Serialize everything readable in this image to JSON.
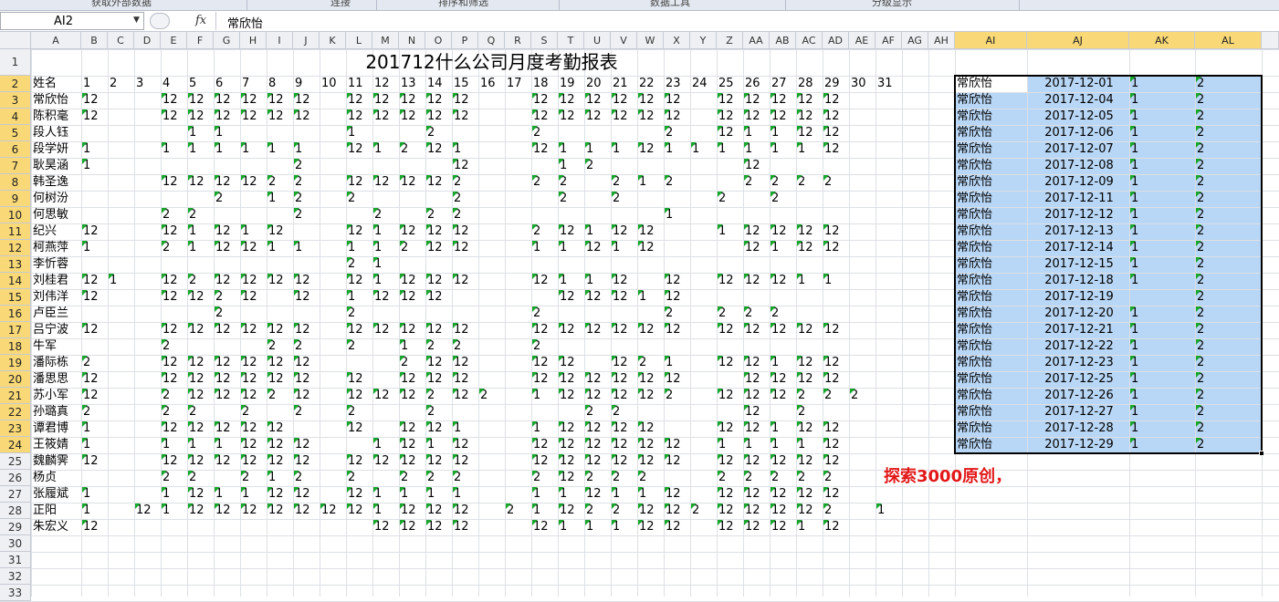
{
  "ribbon": {
    "groups": [
      "获取外部数据",
      "连接",
      "排序和筛选",
      "数据工具",
      "分级显示"
    ]
  },
  "formula_bar": {
    "name_box": "AI2",
    "fx": "fx",
    "content": "常欣怡"
  },
  "columns": [
    "A",
    "B",
    "C",
    "D",
    "E",
    "F",
    "G",
    "H",
    "I",
    "J",
    "K",
    "L",
    "M",
    "N",
    "O",
    "P",
    "Q",
    "R",
    "S",
    "T",
    "U",
    "V",
    "W",
    "X",
    "Y",
    "Z",
    "AA",
    "AB",
    "AC",
    "AD",
    "AE",
    "AF",
    "AG",
    "AH",
    "AI",
    "AJ",
    "AK",
    "AL"
  ],
  "selected_columns": [
    "AI",
    "AJ",
    "AK",
    "AL"
  ],
  "rows": [
    "1",
    "2",
    "3",
    "4",
    "5",
    "6",
    "7",
    "8",
    "9",
    "10",
    "11",
    "12",
    "13",
    "14",
    "15",
    "16",
    "17",
    "18",
    "19",
    "20",
    "21",
    "22",
    "23",
    "24",
    "25",
    "26",
    "27",
    "28",
    "29",
    "30",
    "31",
    "32",
    "33"
  ],
  "selected_rows": [
    "2",
    "3",
    "4",
    "5",
    "6",
    "7",
    "8",
    "9",
    "10",
    "11",
    "12",
    "13",
    "14",
    "15",
    "16",
    "17",
    "18",
    "19",
    "20",
    "21",
    "22",
    "23",
    "24"
  ],
  "sheet": {
    "title": "201712什么公司月度考勤报表",
    "header_label": "姓名",
    "days": [
      "1",
      "2",
      "3",
      "4",
      "5",
      "6",
      "7",
      "8",
      "9",
      "10",
      "11",
      "12",
      "13",
      "14",
      "15",
      "16",
      "17",
      "18",
      "19",
      "20",
      "21",
      "22",
      "23",
      "24",
      "25",
      "26",
      "27",
      "28",
      "29",
      "30",
      "31"
    ],
    "employees": [
      {
        "name": "常欣怡",
        "v": [
          "12",
          "",
          "",
          "12",
          "12",
          "12",
          "12",
          "12",
          "12",
          "",
          "12",
          "12",
          "12",
          "12",
          "12",
          "",
          "",
          "12",
          "12",
          "12",
          "12",
          "12",
          "12",
          "",
          "12",
          "12",
          "12",
          "12",
          "12",
          "",
          ""
        ]
      },
      {
        "name": "陈积毫",
        "v": [
          "12",
          "",
          "",
          "12",
          "12",
          "12",
          "12",
          "12",
          "12",
          "",
          "12",
          "12",
          "12",
          "12",
          "12",
          "",
          "",
          "12",
          "12",
          "12",
          "12",
          "12",
          "12",
          "",
          "12",
          "12",
          "12",
          "12",
          "12",
          "",
          ""
        ]
      },
      {
        "name": "段人钰",
        "v": [
          "",
          "",
          "",
          "",
          "1",
          "1",
          "",
          "",
          "",
          "",
          "1",
          "",
          "",
          "2",
          "",
          "",
          "",
          "2",
          "",
          "",
          "",
          "",
          "2",
          "",
          "12",
          "1",
          "1",
          "12",
          "12",
          "",
          ""
        ]
      },
      {
        "name": "段学妍",
        "v": [
          "1",
          "",
          "",
          "1",
          "1",
          "1",
          "1",
          "1",
          "1",
          "",
          "12",
          "1",
          "2",
          "12",
          "1",
          "",
          "",
          "12",
          "1",
          "1",
          "1",
          "12",
          "1",
          "1",
          "1",
          "1",
          "1",
          "1",
          "12",
          "",
          ""
        ]
      },
      {
        "name": "耿昊涵",
        "v": [
          "1",
          "",
          "",
          "",
          "",
          "",
          "",
          "",
          "2",
          "",
          "",
          "",
          "",
          "",
          "12",
          "",
          "",
          "",
          "1",
          "2",
          "",
          "",
          "",
          "",
          "",
          "12",
          "",
          "",
          "",
          "",
          ""
        ]
      },
      {
        "name": "韩圣逸",
        "v": [
          "",
          "",
          "",
          "12",
          "12",
          "12",
          "12",
          "2",
          "2",
          "",
          "12",
          "12",
          "12",
          "12",
          "2",
          "",
          "",
          "2",
          "2",
          "",
          "2",
          "1",
          "2",
          "",
          "",
          "2",
          "2",
          "2",
          "2",
          "",
          ""
        ]
      },
      {
        "name": "何树汾",
        "v": [
          "",
          "",
          "",
          "",
          "",
          "2",
          "",
          "1",
          "2",
          "",
          "2",
          "",
          "",
          "",
          "2",
          "",
          "",
          "",
          "2",
          "",
          "2",
          "",
          "",
          "",
          "2",
          "",
          "2",
          "",
          "",
          "",
          ""
        ]
      },
      {
        "name": "何思敏",
        "v": [
          "",
          "",
          "",
          "2",
          "2",
          "",
          "",
          "",
          "2",
          "",
          "",
          "2",
          "",
          "2",
          "2",
          "",
          "",
          "",
          "",
          "",
          "",
          "",
          "1",
          "",
          "",
          "",
          "",
          "",
          "",
          "",
          ""
        ]
      },
      {
        "name": "纪兴",
        "v": [
          "12",
          "",
          "",
          "12",
          "1",
          "12",
          "1",
          "12",
          "",
          "",
          "12",
          "1",
          "12",
          "12",
          "12",
          "",
          "",
          "2",
          "12",
          "1",
          "12",
          "12",
          "",
          "",
          "1",
          "12",
          "12",
          "12",
          "12",
          "",
          ""
        ]
      },
      {
        "name": "柯燕萍",
        "v": [
          "1",
          "",
          "",
          "2",
          "1",
          "12",
          "12",
          "1",
          "1",
          "",
          "1",
          "1",
          "2",
          "12",
          "12",
          "",
          "",
          "1",
          "1",
          "12",
          "1",
          "12",
          "",
          "",
          "",
          "12",
          "1",
          "12",
          "12",
          "",
          ""
        ]
      },
      {
        "name": "李忻蓉",
        "v": [
          "",
          "",
          "",
          "",
          "",
          "",
          "",
          "",
          "",
          "",
          "2",
          "1",
          "",
          "",
          "",
          "",
          "",
          "",
          "",
          "",
          "",
          "",
          "",
          "",
          "",
          "",
          "",
          "",
          "",
          "",
          ""
        ]
      },
      {
        "name": "刘桂君",
        "v": [
          "12",
          "1",
          "",
          "12",
          "2",
          "12",
          "12",
          "12",
          "12",
          "",
          "12",
          "1",
          "12",
          "12",
          "12",
          "",
          "",
          "12",
          "1",
          "1",
          "12",
          "",
          "12",
          "",
          "12",
          "12",
          "12",
          "1",
          "1",
          "",
          ""
        ]
      },
      {
        "name": "刘伟洋",
        "v": [
          "12",
          "",
          "",
          "12",
          "12",
          "2",
          "12",
          "",
          "12",
          "",
          "1",
          "12",
          "12",
          "12",
          "",
          "",
          "",
          "",
          "12",
          "12",
          "12",
          "1",
          "12",
          "",
          "",
          "",
          "",
          "",
          "",
          "",
          ""
        ]
      },
      {
        "name": "卢臣兰",
        "v": [
          "",
          "",
          "",
          "",
          "",
          "2",
          "",
          "",
          "",
          "",
          "2",
          "",
          "",
          "",
          "",
          "",
          "",
          "2",
          "",
          "",
          "",
          "",
          "2",
          "",
          "2",
          "2",
          "2",
          "",
          "",
          "",
          ""
        ]
      },
      {
        "name": "吕宁波",
        "v": [
          "12",
          "",
          "",
          "12",
          "12",
          "12",
          "12",
          "12",
          "12",
          "",
          "12",
          "12",
          "12",
          "12",
          "12",
          "",
          "",
          "12",
          "12",
          "12",
          "12",
          "12",
          "12",
          "",
          "12",
          "12",
          "12",
          "12",
          "12",
          "",
          ""
        ]
      },
      {
        "name": "牛军",
        "v": [
          "",
          "",
          "",
          "2",
          "",
          "",
          "",
          "2",
          "2",
          "",
          "2",
          "",
          "1",
          "2",
          "2",
          "",
          "",
          "2",
          "",
          "",
          "",
          "",
          "",
          "",
          "",
          "",
          "",
          "",
          "",
          "",
          ""
        ]
      },
      {
        "name": "潘际栋",
        "v": [
          "2",
          "",
          "",
          "12",
          "12",
          "12",
          "12",
          "12",
          "12",
          "",
          "",
          "",
          "2",
          "12",
          "12",
          "",
          "",
          "12",
          "12",
          "",
          "12",
          "2",
          "1",
          "",
          "12",
          "12",
          "1",
          "12",
          "12",
          "",
          ""
        ]
      },
      {
        "name": "潘思思",
        "v": [
          "12",
          "",
          "",
          "12",
          "12",
          "12",
          "12",
          "12",
          "12",
          "",
          "12",
          "",
          "12",
          "12",
          "12",
          "",
          "",
          "12",
          "12",
          "12",
          "12",
          "12",
          "12",
          "",
          "",
          "12",
          "12",
          "12",
          "12",
          "",
          ""
        ]
      },
      {
        "name": "苏小军",
        "v": [
          "12",
          "",
          "",
          "2",
          "12",
          "12",
          "12",
          "2",
          "12",
          "",
          "12",
          "12",
          "12",
          "2",
          "12",
          "2",
          "",
          "1",
          "12",
          "12",
          "12",
          "12",
          "2",
          "",
          "12",
          "12",
          "12",
          "2",
          "2",
          "2",
          ""
        ]
      },
      {
        "name": "孙璐真",
        "v": [
          "2",
          "",
          "",
          "2",
          "2",
          "",
          "2",
          "",
          "2",
          "",
          "2",
          "",
          "",
          "2",
          "",
          "",
          "",
          "",
          "",
          "2",
          "2",
          "",
          "",
          "",
          "",
          "12",
          "",
          "2",
          "",
          "",
          ""
        ]
      },
      {
        "name": "谭君博",
        "v": [
          "1",
          "",
          "",
          "12",
          "12",
          "12",
          "12",
          "12",
          "",
          "",
          "12",
          "",
          "12",
          "12",
          "1",
          "",
          "",
          "1",
          "12",
          "12",
          "12",
          "12",
          "",
          "",
          "12",
          "12",
          "1",
          "12",
          "12",
          "",
          ""
        ]
      },
      {
        "name": "王筱婧",
        "v": [
          "1",
          "",
          "",
          "1",
          "1",
          "1",
          "12",
          "12",
          "12",
          "",
          "",
          "1",
          "12",
          "1",
          "12",
          "",
          "",
          "12",
          "12",
          "12",
          "12",
          "12",
          "12",
          "",
          "1",
          "1",
          "1",
          "1",
          "12",
          "",
          ""
        ]
      },
      {
        "name": "魏麟霁",
        "v": [
          "12",
          "",
          "",
          "12",
          "12",
          "12",
          "12",
          "12",
          "12",
          "",
          "12",
          "12",
          "12",
          "12",
          "12",
          "",
          "",
          "12",
          "12",
          "12",
          "12",
          "12",
          "12",
          "",
          "12",
          "12",
          "12",
          "12",
          "12",
          "",
          ""
        ]
      },
      {
        "name": "杨贞",
        "v": [
          "",
          "",
          "",
          "2",
          "2",
          "",
          "2",
          "1",
          "2",
          "",
          "2",
          "",
          "2",
          "2",
          "2",
          "",
          "",
          "2",
          "12",
          "2",
          "2",
          "2",
          "",
          "",
          "2",
          "2",
          "2",
          "2",
          "2",
          "",
          ""
        ]
      },
      {
        "name": "张履斌",
        "v": [
          "1",
          "",
          "",
          "1",
          "12",
          "1",
          "1",
          "12",
          "12",
          "",
          "12",
          "1",
          "1",
          "1",
          "1",
          "",
          "",
          "1",
          "1",
          "12",
          "1",
          "1",
          "12",
          "",
          "12",
          "12",
          "12",
          "12",
          "12",
          "",
          ""
        ]
      },
      {
        "name": "正阳",
        "v": [
          "1",
          "",
          "12",
          "1",
          "12",
          "12",
          "12",
          "12",
          "12",
          "12",
          "12",
          "1",
          "12",
          "12",
          "12",
          "",
          "2",
          "1",
          "12",
          "2",
          "2",
          "12",
          "12",
          "2",
          "12",
          "12",
          "12",
          "12",
          "2",
          "",
          "1"
        ]
      },
      {
        "name": "朱宏义",
        "v": [
          "12",
          "",
          "",
          "",
          "",
          "",
          "",
          "",
          "",
          "",
          "",
          "12",
          "12",
          "12",
          "12",
          "",
          "",
          "12",
          "1",
          "1",
          "1",
          "12",
          "12",
          "",
          "12",
          "12",
          "12",
          "1",
          "12",
          "",
          ""
        ]
      }
    ],
    "side_table": {
      "name": "常欣怡",
      "rows": [
        {
          "date": "2017-12-01",
          "k": "1",
          "l": "2"
        },
        {
          "date": "2017-12-04",
          "k": "1",
          "l": "2"
        },
        {
          "date": "2017-12-05",
          "k": "1",
          "l": "2"
        },
        {
          "date": "2017-12-06",
          "k": "1",
          "l": "2"
        },
        {
          "date": "2017-12-07",
          "k": "1",
          "l": "2"
        },
        {
          "date": "2017-12-08",
          "k": "1",
          "l": "2"
        },
        {
          "date": "2017-12-09",
          "k": "1",
          "l": "2"
        },
        {
          "date": "2017-12-11",
          "k": "1",
          "l": "2"
        },
        {
          "date": "2017-12-12",
          "k": "1",
          "l": "2"
        },
        {
          "date": "2017-12-13",
          "k": "1",
          "l": "2"
        },
        {
          "date": "2017-12-14",
          "k": "1",
          "l": "2"
        },
        {
          "date": "2017-12-15",
          "k": "1",
          "l": "2"
        },
        {
          "date": "2017-12-18",
          "k": "1",
          "l": "2"
        },
        {
          "date": "2017-12-19",
          "k": "",
          "l": "2"
        },
        {
          "date": "2017-12-20",
          "k": "1",
          "l": "2"
        },
        {
          "date": "2017-12-21",
          "k": "1",
          "l": "2"
        },
        {
          "date": "2017-12-22",
          "k": "1",
          "l": "2"
        },
        {
          "date": "2017-12-23",
          "k": "1",
          "l": "2"
        },
        {
          "date": "2017-12-25",
          "k": "1",
          "l": "2"
        },
        {
          "date": "2017-12-26",
          "k": "1",
          "l": "2"
        },
        {
          "date": "2017-12-27",
          "k": "1",
          "l": "2"
        },
        {
          "date": "2017-12-28",
          "k": "1",
          "l": "2"
        },
        {
          "date": "2017-12-29",
          "k": "1",
          "l": "2"
        }
      ]
    }
  },
  "promo_text": "探索3000原创，",
  "colors": {
    "selection_fill": "#b8d6f5",
    "selected_header": "#f9d977",
    "text_marker": "#18a62d",
    "promo": "#e21818"
  }
}
